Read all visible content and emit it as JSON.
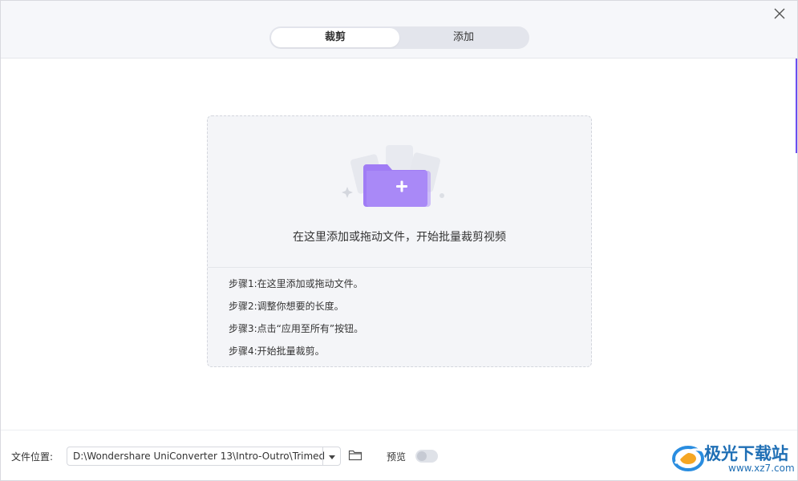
{
  "tabs": [
    {
      "label": "裁剪",
      "active": true
    },
    {
      "label": "添加",
      "active": false
    }
  ],
  "dropzone": {
    "title": "在这里添加或拖动文件，开始批量裁剪视频",
    "steps": [
      "步骤1:在这里添加或拖动文件。",
      "步骤2:调整你想要的长度。",
      "步骤3:点击“应用至所有”按钮。",
      "步骤4:开始批量裁剪。"
    ]
  },
  "footer": {
    "location_label": "文件位置:",
    "location_value": "D:\\Wondershare UniConverter 13\\Intro-Outro\\Trimed",
    "preview_label": "预览",
    "preview_enabled": false
  },
  "watermark": {
    "name": "极光下载站",
    "url": "www.xz7.com"
  },
  "colors": {
    "accent": "#6b4df0",
    "folder": "#a07cf5",
    "header_bg": "#f6f7fa",
    "dropzone_bg": "#f4f5f8"
  },
  "icons": {
    "close": "close-icon",
    "folder_add": "folder-add-icon",
    "dropdown": "chevron-down-icon",
    "open_folder": "folder-icon"
  }
}
